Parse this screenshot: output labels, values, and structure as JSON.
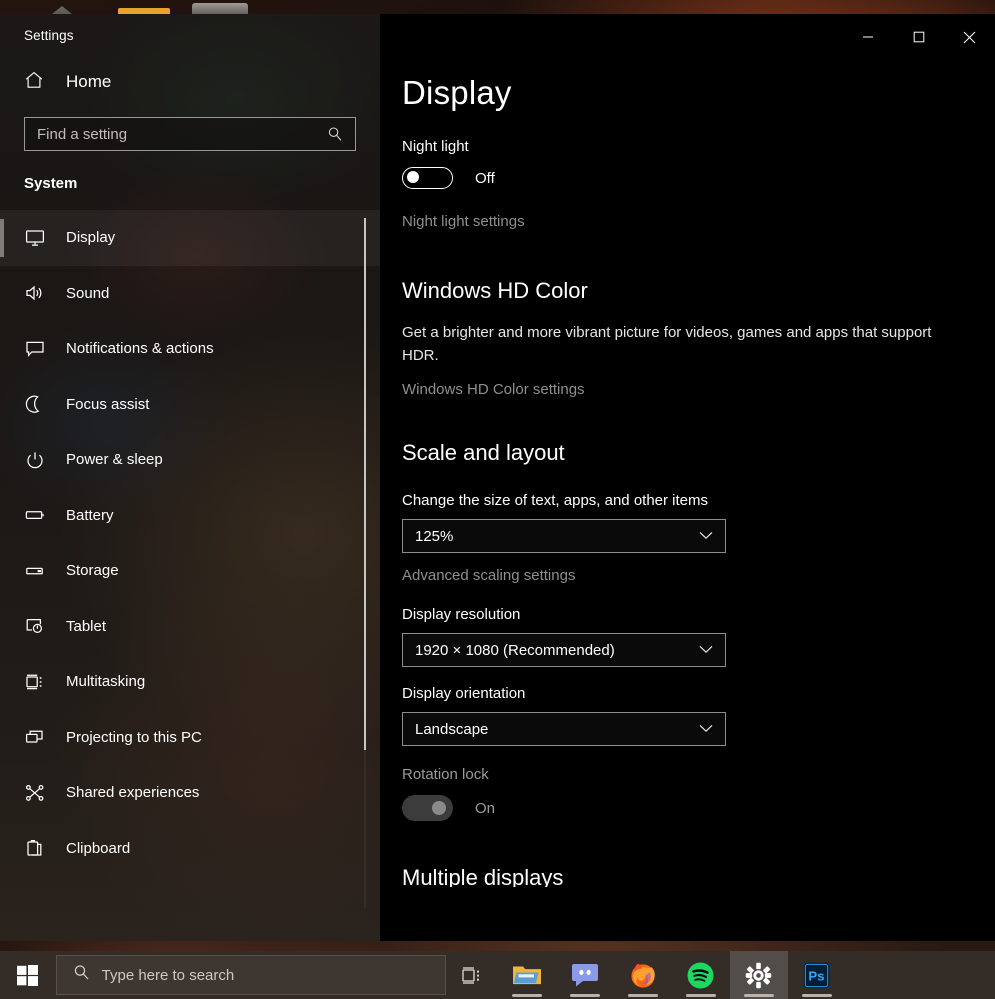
{
  "window": {
    "title": "Settings",
    "controls": {
      "minimize": "minimize-button",
      "maximize": "maximize-button",
      "close": "close-button"
    }
  },
  "sidebar": {
    "home_label": "Home",
    "home_icon": "home-icon",
    "search": {
      "placeholder": "Find a setting",
      "value": "",
      "icon": "search-icon"
    },
    "section_label": "System",
    "items": [
      {
        "label": "Display",
        "icon": "monitor-icon",
        "selected": true
      },
      {
        "label": "Sound",
        "icon": "speaker-icon",
        "selected": false
      },
      {
        "label": "Notifications & actions",
        "icon": "chat-bubble-icon",
        "selected": false
      },
      {
        "label": "Focus assist",
        "icon": "moon-icon",
        "selected": false
      },
      {
        "label": "Power & sleep",
        "icon": "power-icon",
        "selected": false
      },
      {
        "label": "Battery",
        "icon": "battery-icon",
        "selected": false
      },
      {
        "label": "Storage",
        "icon": "storage-icon",
        "selected": false
      },
      {
        "label": "Tablet",
        "icon": "tablet-icon",
        "selected": false
      },
      {
        "label": "Multitasking",
        "icon": "multitasking-icon",
        "selected": false
      },
      {
        "label": "Projecting to this PC",
        "icon": "projecting-icon",
        "selected": false
      },
      {
        "label": "Shared experiences",
        "icon": "share-icon",
        "selected": false
      },
      {
        "label": "Clipboard",
        "icon": "clipboard-icon",
        "selected": false
      }
    ]
  },
  "main": {
    "page_title": "Display",
    "night_light": {
      "label": "Night light",
      "toggle_state": "Off",
      "settings_link": "Night light settings"
    },
    "hd_color": {
      "heading": "Windows HD Color",
      "description": "Get a brighter and more vibrant picture for videos, games and apps that support HDR.",
      "settings_link": "Windows HD Color settings"
    },
    "scale_layout": {
      "heading": "Scale and layout",
      "scale_label": "Change the size of text, apps, and other items",
      "scale_value": "125%",
      "advanced_link": "Advanced scaling settings",
      "resolution_label": "Display resolution",
      "resolution_value": "1920 × 1080 (Recommended)",
      "orientation_label": "Display orientation",
      "orientation_value": "Landscape",
      "rotation_lock_label": "Rotation lock",
      "rotation_lock_state": "On"
    },
    "multiple_displays_heading": "Multiple displays"
  },
  "taskbar": {
    "start_label": "start-button",
    "search_placeholder": "Type here to search",
    "search_icon": "search-icon",
    "task_view": "task-view-button",
    "apps": [
      {
        "name": "file-explorer",
        "label": "File Explorer",
        "active": false,
        "running": true
      },
      {
        "name": "discord",
        "label": "Discord",
        "active": false,
        "running": true
      },
      {
        "name": "firefox",
        "label": "Firefox",
        "active": false,
        "running": true
      },
      {
        "name": "spotify",
        "label": "Spotify",
        "active": false,
        "running": true
      },
      {
        "name": "settings",
        "label": "Settings",
        "active": true,
        "running": true
      },
      {
        "name": "photoshop",
        "label": "Photoshop",
        "active": false,
        "running": true
      }
    ]
  },
  "colors": {
    "accent_taskbar": "#332c27",
    "content_bg": "#000000",
    "text_primary": "#ffffff",
    "text_dim": "#8f8f8f",
    "combo_border": "#8c8c8c",
    "spotify_green": "#1ed760",
    "discord_blurple": "#8b9ae8",
    "firefox_orange": "#ff7139",
    "photoshop_blue": "#001e36",
    "photoshop_accent": "#31a8ff",
    "folder_yellow": "#f5ba4b"
  }
}
